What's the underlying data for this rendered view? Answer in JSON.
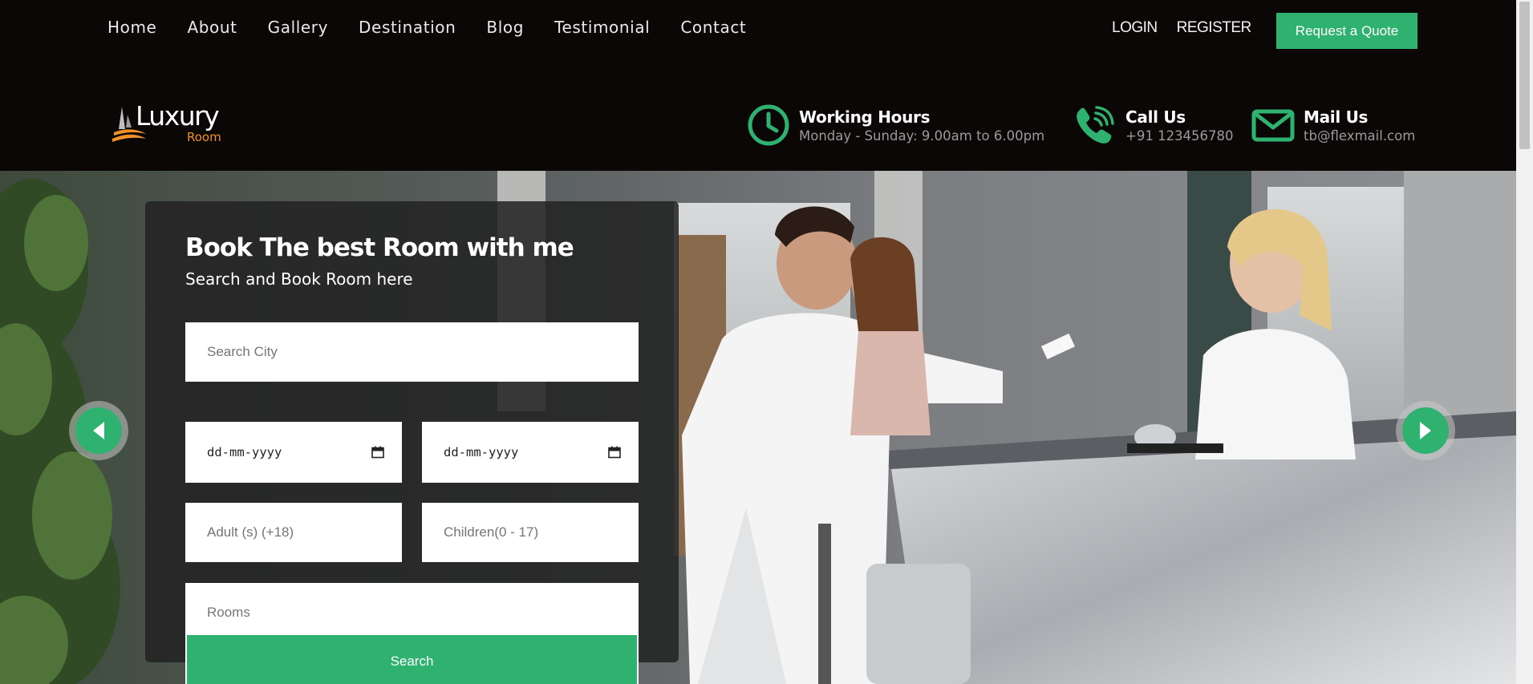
{
  "nav": {
    "links": [
      "Home",
      "About",
      "Gallery",
      "Destination",
      "Blog",
      "Testimonial",
      "Contact"
    ],
    "login": "LOGIN",
    "register": "REGISTER",
    "quote_button": "Request a Quote"
  },
  "header": {
    "logo": {
      "word": "Luxury",
      "sub": "Room"
    },
    "working_hours": {
      "title": "Working Hours",
      "detail": "Monday - Sunday: 9.00am to 6.00pm",
      "icon": "clock-icon"
    },
    "call": {
      "title": "Call Us",
      "detail": "+91 123456780",
      "icon": "phone-icon"
    },
    "mail": {
      "title": "Mail Us",
      "detail": "tb@flexmail.com",
      "icon": "envelope-icon"
    }
  },
  "booking": {
    "title": "Book The best Room with me",
    "subtitle": "Search and Book Room here",
    "city_placeholder": "Search City",
    "checkin_value": "dd-mm-yyyy",
    "checkout_value": "dd-mm-yyyy",
    "adults_placeholder": "Adult (s) (+18)",
    "children_placeholder": "Children(0 - 17)",
    "rooms_placeholder": "Rooms",
    "search_label": "Search"
  },
  "colors": {
    "accent": "#2fb170",
    "background": "#0b0707",
    "logo_orange": "#f39224"
  }
}
